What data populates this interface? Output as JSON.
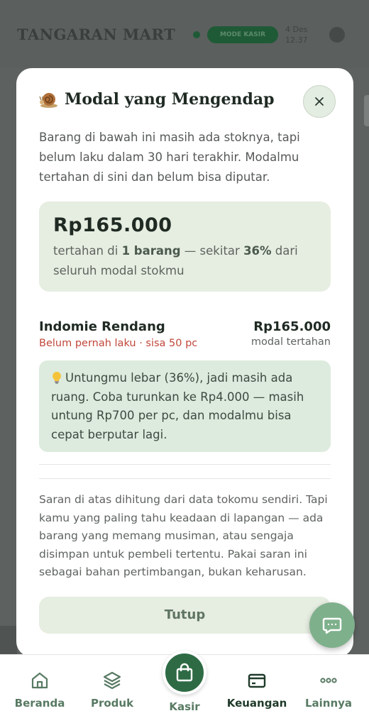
{
  "background": {
    "brand": "TANGARAN MART",
    "status_pill": "MODE KASIR",
    "date_line1": "4 Des",
    "date_line2": "12.37"
  },
  "modal": {
    "title": "Modal yang Mengendap",
    "title_icon": "snail-icon",
    "close_label": "×",
    "intro": "Barang di bawah ini masih ada stoknya, tapi belum laku dalam 30 hari terakhir. Modalmu tertahan di sini dan belum bisa diputar.",
    "summary": {
      "amount": "Rp165.000",
      "text_prefix": "tertahan di ",
      "count": "1 barang",
      "text_middle": " — sekitar ",
      "percent": "36%",
      "text_suffix": " dari seluruh modal stokmu"
    },
    "item": {
      "name": "Indomie Rendang",
      "status": "Belum pernah laku · sisa 50 pc",
      "price": "Rp165.000",
      "price_label": "modal tertahan"
    },
    "tip": {
      "icon": "lightbulb-icon",
      "text": "Untungmu lebar (36%), jadi masih ada ruang. Coba turunkan ke Rp4.000 — masih untung Rp700 per pc, dan modalmu bisa cepat berputar lagi."
    },
    "note": "Saran di atas dihitung dari data tokomu sendiri. Tapi kamu yang paling tahu keadaan di lapangan — ada barang yang memang musiman, atau sengaja disimpan untuk pembeli tertentu. Pakai saran ini sebagai bahan pertimbangan, bukan keharusan.",
    "close_button": "Tutup"
  },
  "nav": {
    "items": [
      {
        "label": "Beranda",
        "icon": "home-icon"
      },
      {
        "label": "Produk",
        "icon": "box-icon"
      },
      {
        "label": "Kasir",
        "icon": "shopping-bag-icon"
      },
      {
        "label": "Keuangan",
        "icon": "wallet-icon"
      },
      {
        "label": "Lainnya",
        "icon": "more-icon"
      }
    ]
  },
  "colors": {
    "primary": "#2e6b45",
    "accent_soft": "#e6ede1",
    "tip_bg": "#dcebdd",
    "danger": "#c0473a",
    "overlay": "#5d6160"
  }
}
